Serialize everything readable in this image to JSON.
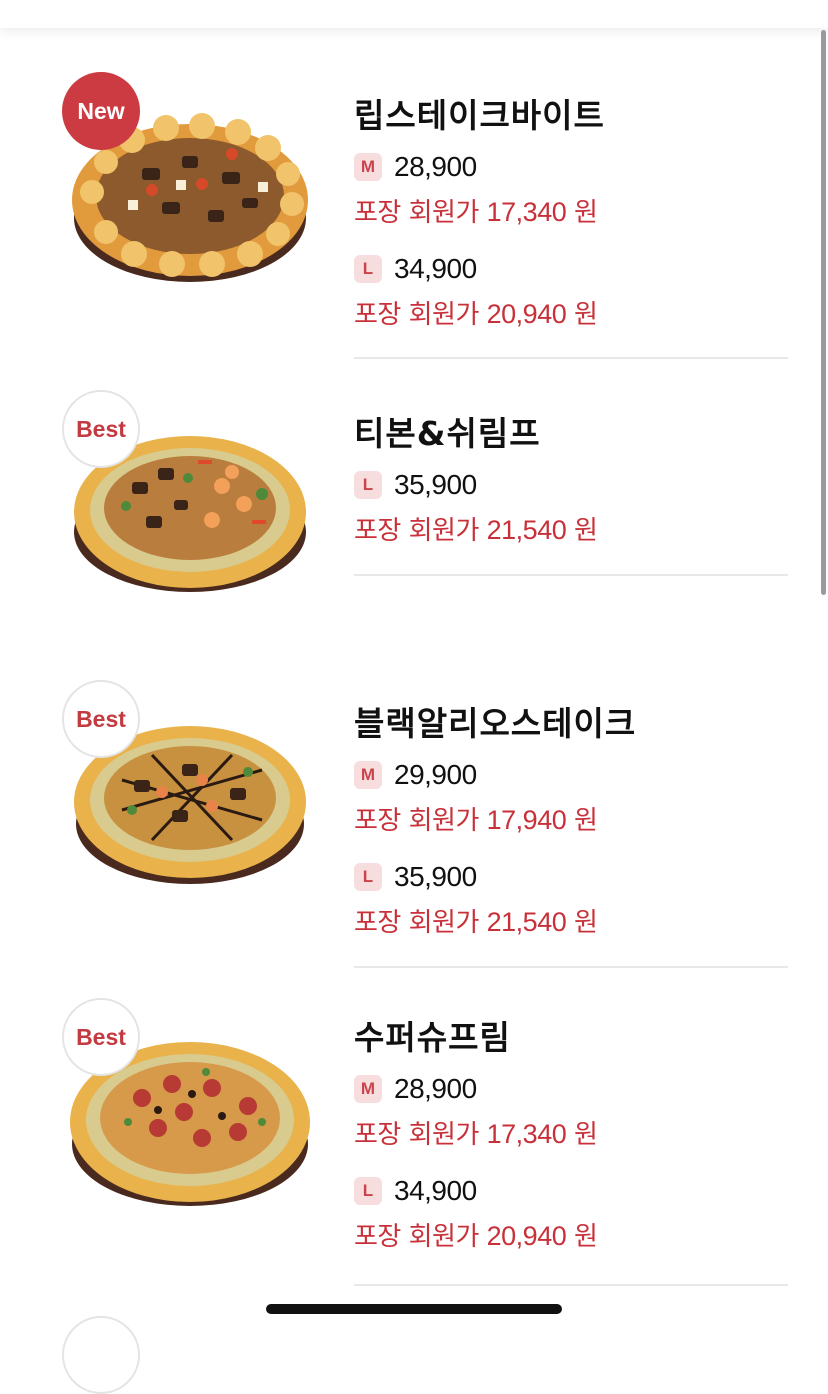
{
  "menu": {
    "items": [
      {
        "badge": "New",
        "name": "립스테이크바이트",
        "prices": [
          {
            "size": "M",
            "price": "28,900",
            "member_prefix": "포장 회원가",
            "member_price": "17,340",
            "unit": "원"
          },
          {
            "size": "L",
            "price": "34,900",
            "member_prefix": "포장 회원가",
            "member_price": "20,940",
            "unit": "원"
          }
        ]
      },
      {
        "badge": "Best",
        "name": "티본&쉬림프",
        "prices": [
          {
            "size": "L",
            "price": "35,900",
            "member_prefix": "포장 회원가",
            "member_price": "21,540",
            "unit": "원"
          }
        ]
      },
      {
        "badge": "Best",
        "name": "블랙알리오스테이크",
        "prices": [
          {
            "size": "M",
            "price": "29,900",
            "member_prefix": "포장 회원가",
            "member_price": "17,940",
            "unit": "원"
          },
          {
            "size": "L",
            "price": "35,900",
            "member_prefix": "포장 회원가",
            "member_price": "21,540",
            "unit": "원"
          }
        ]
      },
      {
        "badge": "Best",
        "name": "수퍼슈프림",
        "prices": [
          {
            "size": "M",
            "price": "28,900",
            "member_prefix": "포장 회원가",
            "member_price": "17,340",
            "unit": "원"
          },
          {
            "size": "L",
            "price": "34,900",
            "member_prefix": "포장 회원가",
            "member_price": "20,940",
            "unit": "원"
          }
        ]
      }
    ]
  },
  "colors": {
    "accent": "#c8313a",
    "new_badge_bg": "#cc3b42",
    "size_chip_bg": "#f8dddf"
  },
  "icons": {
    "thumbnail": "pizza-image",
    "home_indicator": "home-indicator-bar"
  }
}
